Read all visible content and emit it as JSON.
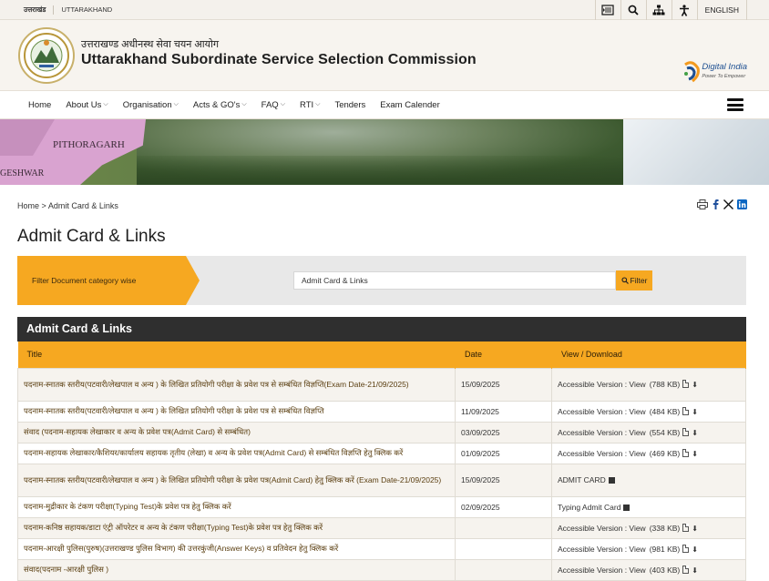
{
  "topbar": {
    "gov_hi": "उत्तराखंड",
    "gov_en": "UTTARAKHAND",
    "language": "ENGLISH"
  },
  "header": {
    "title_hi": "उत्तराखण्ड अधीनस्थ सेवा चयन आयोग",
    "title_en": "Uttarakhand Subordinate Service Selection Commission",
    "digital_india": "Digital India",
    "digital_india_tagline": "Power To Empower"
  },
  "nav": {
    "items": [
      {
        "label": "Home"
      },
      {
        "label": "About Us"
      },
      {
        "label": "Organisation"
      },
      {
        "label": "Acts & GO's"
      },
      {
        "label": "FAQ"
      },
      {
        "label": "RTI"
      },
      {
        "label": "Tenders"
      },
      {
        "label": "Exam Calender"
      }
    ]
  },
  "banner": {
    "label_1": "PITHORAGARH",
    "label_2": "GESHWAR"
  },
  "breadcrumb": {
    "home": "Home",
    "separator": ">",
    "current": "Admit Card & Links"
  },
  "page": {
    "title": "Admit Card & Links"
  },
  "filter": {
    "label": "Filter Document category wise",
    "value": "Admit Card & Links",
    "button": "Filter"
  },
  "table": {
    "caption": "Admit Card & Links",
    "columns": [
      "Title",
      "Date",
      "View / Download"
    ],
    "rows": [
      {
        "title": "पदनाम-स्नातक स्तरीय(पटवारी/लेखपाल व अन्य ) के लिखित प्रतियोगी परीक्षा के प्रवेश पत्र से सम्बंधित विज्ञप्ति(Exam Date-21/09/2025)",
        "date": "15/09/2025",
        "view": "Accessible Version : View",
        "size": "(788 KB)"
      },
      {
        "title": "पदनाम-स्नातक स्तरीय(पटवारी/लेखपाल व अन्य ) के लिखित प्रतियोगी परीक्षा के प्रवेश पत्र से सम्बंधित विज्ञप्ति",
        "date": "11/09/2025",
        "view": "Accessible Version : View",
        "size": "(484 KB)"
      },
      {
        "title": "संवाद (पदनाम-सहायक लेखाकार व अन्य के प्रवेश पत्र(Admit Card) से सम्बंधित)",
        "date": "03/09/2025",
        "view": "Accessible Version : View",
        "size": "(554 KB)"
      },
      {
        "title": "पदनाम-सहायक लेखाकार/कैशियर/कार्यालय सहायक तृतीय (लेखा) व अन्य के प्रवेश पत्र(Admit Card) से सम्बंधित विज्ञप्ति हेतु क्लिक करें",
        "date": "01/09/2025",
        "view": "Accessible Version : View",
        "size": "(469 KB)"
      },
      {
        "title": "पदनाम-स्नातक स्तरीय(पटवारी/लेखपाल व अन्य ) के लिखित प्रतियोगी परीक्षा के प्रवेश पत्र(Admit Card) हेतु क्लिक करें (Exam Date-21/09/2025)",
        "date": "15/09/2025",
        "view": "ADMIT CARD",
        "size": ""
      },
      {
        "title": "पदनाम-मुद्रीकार के टंकण परीक्षा(Typing Test)के प्रवेश पत्र हेतु क्लिक करें",
        "date": "02/09/2025",
        "view": "Typing Admit Card",
        "size": ""
      },
      {
        "title": "पदनाम-कनिष्ठ सहायक/डाटा एंट्री ऑपरेटर व अन्य के टंकण परीक्षा(Typing Test)के प्रवेश पत्र हेतु क्लिक करें",
        "date": "",
        "view": "Accessible Version : View",
        "size": "(338 KB)"
      },
      {
        "title": "पदनाम-आरक्षी पुलिस(पुरुष)(उत्तराखण्ड पुलिस विभाग) की उत्तरकुंजी(Answer Keys) व प्रतिवेदन हेतु क्लिक करें",
        "date": "",
        "view": "Accessible Version : View",
        "size": "(981 KB)"
      },
      {
        "title": "संवाद(पदनाम -आरक्षी पुलिस )",
        "date": "",
        "view": "Accessible Version : View",
        "size": "(403 KB)"
      }
    ]
  }
}
